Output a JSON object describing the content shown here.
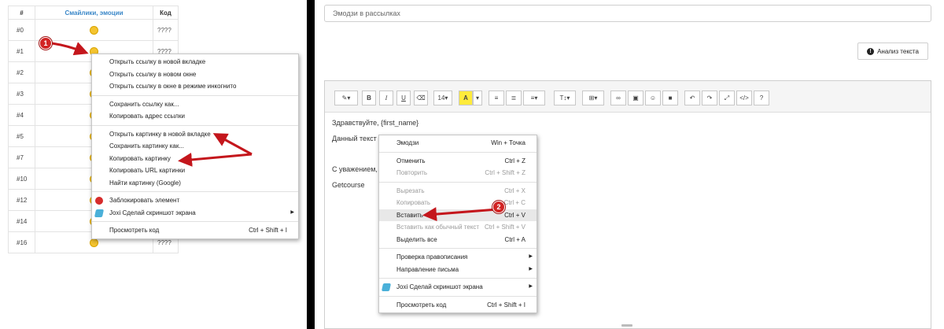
{
  "left": {
    "table": {
      "headers": [
        "#",
        "Смайлики, эмоции",
        "Код"
      ],
      "rows": [
        {
          "num": "#0",
          "code": "????"
        },
        {
          "num": "#1",
          "code": "????"
        },
        {
          "num": "#2",
          "code": ""
        },
        {
          "num": "#3",
          "code": ""
        },
        {
          "num": "#4",
          "code": ""
        },
        {
          "num": "#5",
          "code": ""
        },
        {
          "num": "#7",
          "code": ""
        },
        {
          "num": "#10",
          "code": ""
        },
        {
          "num": "#12",
          "code": ""
        },
        {
          "num": "#14",
          "code": ""
        },
        {
          "num": "#16",
          "code": "????"
        }
      ]
    },
    "context_menu": {
      "items": [
        {
          "label": "Открыть ссылку в новой вкладке"
        },
        {
          "label": "Открыть ссылку в новом окне"
        },
        {
          "label": "Открыть ссылку в окне в режиме инкогнито"
        },
        {
          "label": "Сохранить ссылку как..."
        },
        {
          "label": "Копировать адрес ссылки"
        },
        {
          "label": "Открыть картинку в новой вкладке"
        },
        {
          "label": "Сохранить картинку как..."
        },
        {
          "label": "Копировать картинку"
        },
        {
          "label": "Копировать URL картинки"
        },
        {
          "label": "Найти картинку (Google)"
        },
        {
          "label": "Заблокировать элемент",
          "icon": "stop-icon"
        },
        {
          "label": "Joxi Сделай скриншот экрана",
          "icon": "joxi-icon"
        },
        {
          "label": "Просмотреть код",
          "shortcut": "Ctrl + Shift + I"
        }
      ]
    },
    "badge": "1"
  },
  "right": {
    "title_input": {
      "value": "Эмодзи в рассылках"
    },
    "analyze_button": "Анализ текста",
    "toolbar": {
      "bold": "B",
      "italic": "I",
      "underline": "U",
      "font_size": "14▾",
      "highlight": "A",
      "text_style": "T↕▾",
      "source": "</>",
      "help": "?"
    },
    "editor_lines": [
      "Здравствуйте, {first_name}",
      "Данный текст",
      "С уважением,",
      "Getcourse"
    ],
    "context_menu": {
      "items": [
        {
          "label": "Эмодзи",
          "shortcut": "Win + Точка"
        },
        {
          "label": "Отменить",
          "shortcut": "Ctrl + Z"
        },
        {
          "label": "Повторить",
          "shortcut": "Ctrl + Shift + Z",
          "disabled": true
        },
        {
          "label": "Вырезать",
          "shortcut": "Ctrl + X",
          "disabled": true
        },
        {
          "label": "Копировать",
          "shortcut": "Ctrl + C",
          "disabled": true
        },
        {
          "label": "Вставить",
          "shortcut": "Ctrl + V"
        },
        {
          "label": "Вставить как обычный текст",
          "shortcut": "Ctrl + Shift + V",
          "disabled": true
        },
        {
          "label": "Выделить все",
          "shortcut": "Ctrl + A"
        },
        {
          "label": "Проверка правописания"
        },
        {
          "label": "Направление письма"
        },
        {
          "label": "Joxi Сделай скриншот экрана",
          "icon": "joxi-icon"
        },
        {
          "label": "Просмотреть код",
          "shortcut": "Ctrl + Shift + I"
        }
      ]
    },
    "badge": "2"
  },
  "colors": {
    "accent_red": "#c4161c",
    "link_blue": "#3a87c8",
    "highlight_yellow": "#ffeb3b"
  }
}
